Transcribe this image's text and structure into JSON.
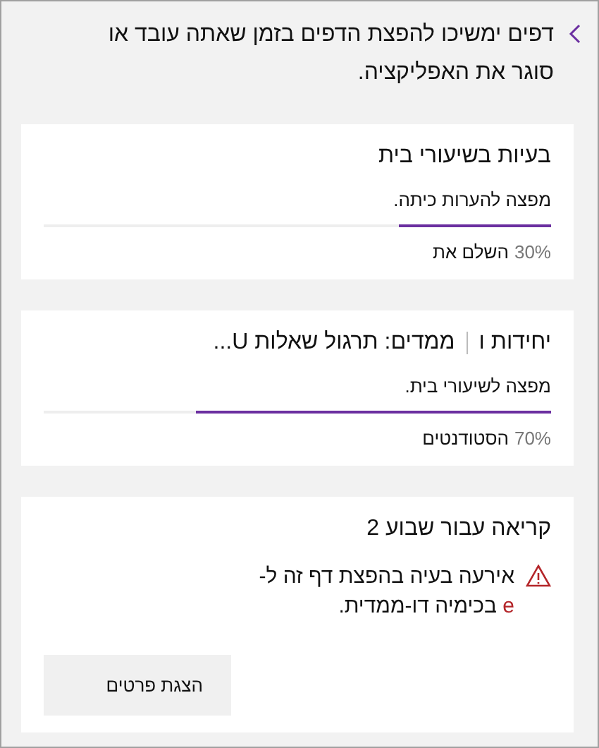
{
  "header": {
    "message": "דפים ימשיכו להפצת הדפים בזמן שאתה עובד או סוגר את האפליקציה."
  },
  "cards": [
    {
      "kind": "progress",
      "title": [
        "בעיות בשיעורי בית"
      ],
      "subtitle": "מפצה להערות כיתה.",
      "level": 0.3,
      "percent": "30%",
      "status": "השלם את"
    },
    {
      "kind": "progress",
      "title": [
        "יחידות ו",
        "ממדים: תרגול שאלות U..."
      ],
      "subtitle": "מפצה לשיעורי בית.",
      "level": 0.7,
      "percent": "70%",
      "status": "הסטודנטים"
    },
    {
      "kind": "error",
      "title": [
        "קריאה עבור שבוע 2"
      ],
      "error_lines": [
        "אירעה בעיה בהפצת דף זה ל-",
        "בכימיה דו-ממדית."
      ],
      "error_mark": "e",
      "button": "הצגת פרטים"
    }
  ]
}
